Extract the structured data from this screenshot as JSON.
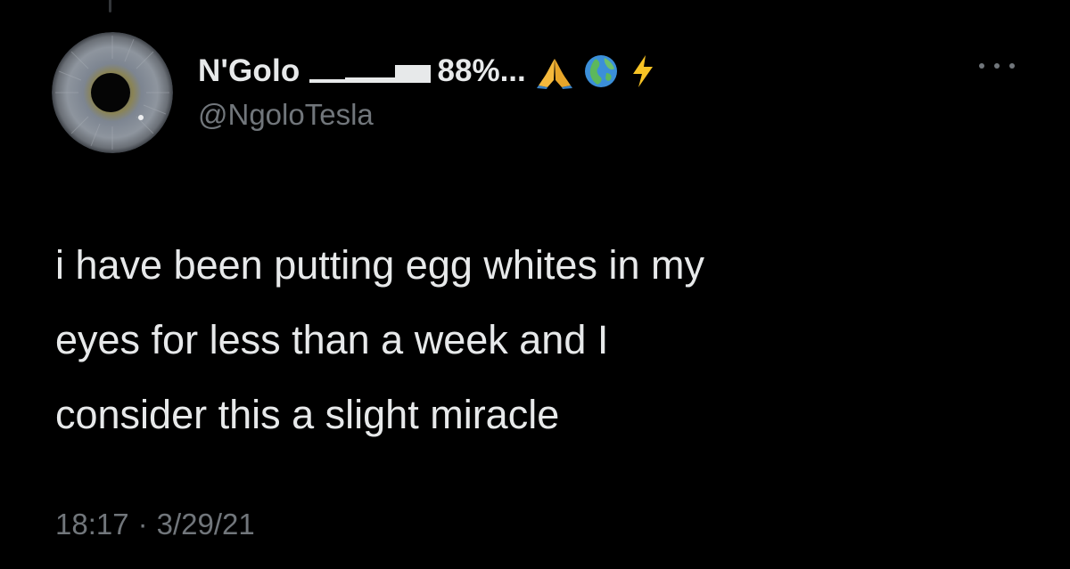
{
  "tweet": {
    "author": {
      "display_name": "N'Golo",
      "battery_percent_label": "88%...",
      "emojis": [
        "folded-hands",
        "globe-africa-europe",
        "high-voltage"
      ],
      "handle": "@NgoloTesla"
    },
    "text_lines": [
      "i have been putting egg whites in my",
      "eyes for less than a week and I",
      "consider this a slight miracle"
    ],
    "time": "18:17",
    "separator": "·",
    "date": "3/29/21"
  },
  "colors": {
    "background": "#000000",
    "primary_text": "#e7e9ea",
    "secondary_text": "#71767b"
  }
}
